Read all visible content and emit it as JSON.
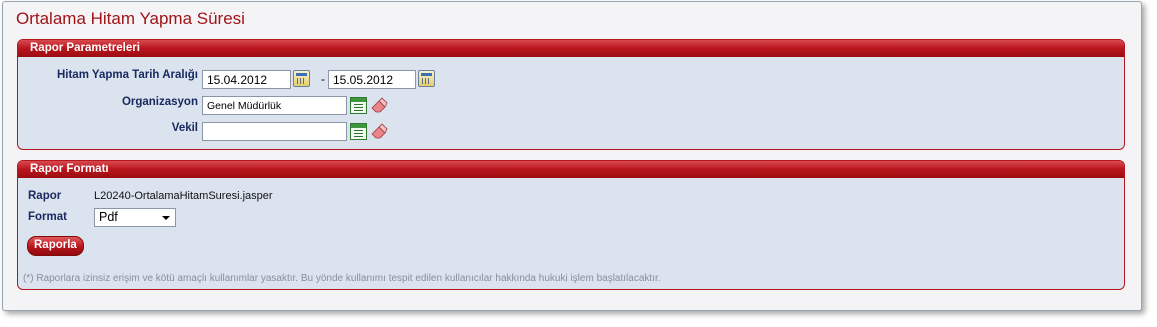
{
  "page": {
    "title": "Ortalama Hitam Yapma Süresi"
  },
  "params": {
    "header": "Rapor Parametreleri",
    "date_range_label": "Hitam Yapma Tarih Aralığı",
    "date_from": "15.04.2012",
    "date_separator": "-",
    "date_to": "15.05.2012",
    "org_label": "Organizasyon",
    "org_value": "Genel Müdürlük",
    "vekil_label": "Vekil",
    "vekil_value": ""
  },
  "format": {
    "header": "Rapor Formatı",
    "rapor_label": "Rapor",
    "rapor_value": "L20240-OrtalamaHitamSuresi.jasper",
    "format_label": "Format",
    "format_value": "Pdf",
    "button_label": "Raporla",
    "note": "(*) Raporlara izinsiz erişim ve kötü amaçlı kullanımlar yasaktır. Bu yönde kullanımı tespit edilen kullanıcılar hakkında hukuki işlem başlatılacaktır."
  },
  "icons": [
    "calendar-icon",
    "list-icon",
    "eraser-icon",
    "chevron-down-icon"
  ],
  "colors": {
    "accent": "#b9151c",
    "panel_bg": "#dbe3ef",
    "label": "#1a2a60"
  }
}
